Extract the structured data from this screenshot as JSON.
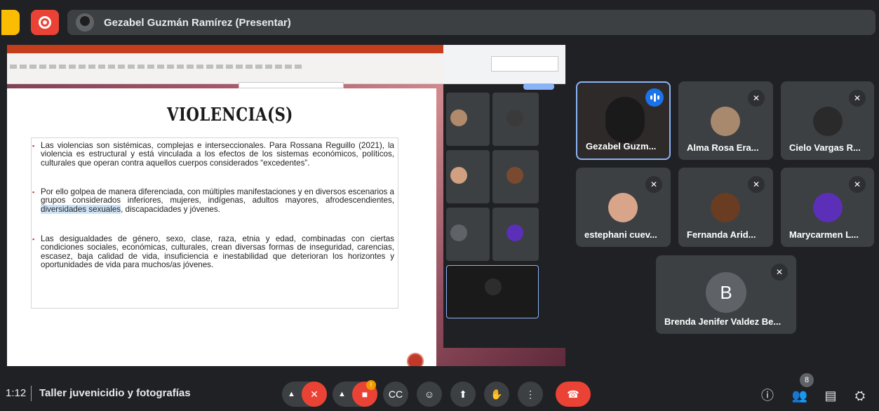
{
  "presenter_bar": {
    "name": "Gezabel Guzmán Ramírez (Presentar)"
  },
  "slide": {
    "title": "VIOLENCIA(S)",
    "bullets": [
      "Las violencias son sistémicas, complejas e interseccionales. Para Rossana Reguillo (2021), la violencia es estructural y está vinculada a los efectos de los sistemas económicos, políticos, culturales que operan contra aquellos cuerpos considerados “excedentes”.",
      "Las desigualdades de género, sexo, clase, raza, etnia y edad, combinadas con ciertas condiciones sociales, económicas, culturales, crean diversas formas de inseguridad, carencias, escasez, baja calidad de vida, insuficiencia e inestabilidad que deterioran los horizontes y oportunidades de vida para muchos/as jóvenes."
    ],
    "bullet2_a": "Por ello golpea de manera diferenciada, con múltiples manifestaciones y en diversos escenarios a grupos considerados inferiores, mujeres, indígenas, adultos mayores, afrodescendientes,",
    "bullet2_hl": "diversidades sexuales",
    "bullet2_b": ", discapacidades y jóvenes."
  },
  "participants": [
    {
      "name": "Gezabel Guzm...",
      "speaking": true
    },
    {
      "name": "Alma Rosa Era...",
      "muted": true
    },
    {
      "name": "Cielo Vargas R...",
      "muted": true
    },
    {
      "name": "estephani cuev...",
      "muted": true
    },
    {
      "name": "Fernanda Arid...",
      "muted": true
    },
    {
      "name": "Marycarmen L...",
      "muted": true
    },
    {
      "name": "Brenda Jenifer Valdez Be...",
      "muted": true,
      "initial": "B"
    }
  ],
  "bottom_bar": {
    "time": "1:12",
    "meeting_title": "Taller juvenicidio y fotografías",
    "participant_count": "8"
  },
  "colors": {
    "background": "#202124",
    "tile": "#3c4043",
    "accent_blue": "#8ab4f8",
    "end_call_red": "#ea4335"
  }
}
